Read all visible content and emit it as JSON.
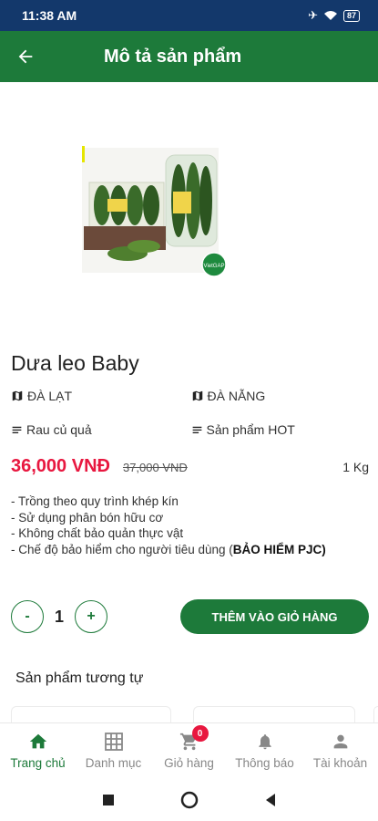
{
  "status_bar": {
    "time": "11:38 AM",
    "battery": "87"
  },
  "header": {
    "title": "Mô tả sản phẩm",
    "back_icon": "arrow-left-icon"
  },
  "product": {
    "image_badge": "VietGAP",
    "name": "Dưa leo Baby",
    "origin": "ĐÀ LẠT",
    "destination": "ĐÀ NẴNG",
    "category": "Rau củ quả",
    "tag": "Sản phẩm HOT",
    "price": "36,000 VNĐ",
    "old_price": "37,000 VNĐ",
    "unit": "1 Kg",
    "description": {
      "line1": "- Trồng theo quy trình khép kín",
      "line2": "- Sử dụng phân bón hữu cơ",
      "line3": "- Không chất bảo quản thực vật",
      "line4_prefix": "- Chế độ bảo hiểm cho người tiêu dùng (",
      "line4_bold": "BẢO HIỂM PJC)"
    }
  },
  "quantity": {
    "minus_label": "-",
    "value": "1",
    "plus_label": "+"
  },
  "add_to_cart_label": "THÊM VÀO GIỎ HÀNG",
  "similar_section_title": "Sản phẩm tương tự",
  "bottom_nav": {
    "items": [
      {
        "label": "Trang chủ",
        "icon": "home-icon",
        "active": true
      },
      {
        "label": "Danh mục",
        "icon": "grid-icon",
        "active": false
      },
      {
        "label": "Giỏ hàng",
        "icon": "cart-icon",
        "active": false,
        "badge": "0"
      },
      {
        "label": "Thông báo",
        "icon": "bell-icon",
        "active": false
      },
      {
        "label": "Tài khoản",
        "icon": "user-icon",
        "active": false
      }
    ]
  },
  "colors": {
    "primary": "#1d7a3a",
    "price": "#e8173f",
    "status_bar": "#13386b"
  }
}
